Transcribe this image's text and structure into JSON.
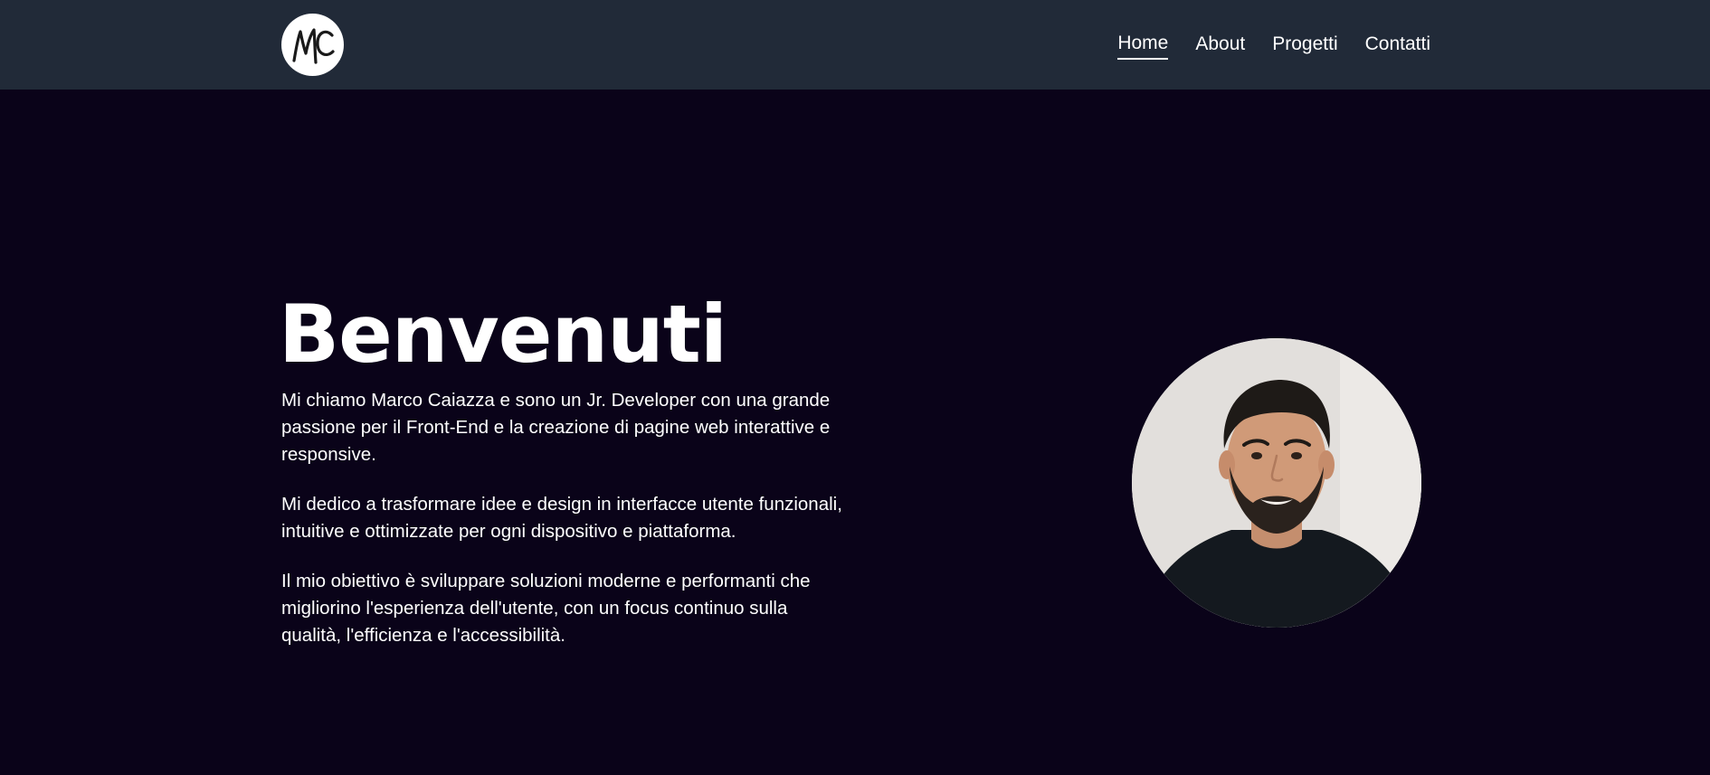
{
  "header": {
    "logo_text": "MC",
    "nav": [
      {
        "label": "Home",
        "active": true
      },
      {
        "label": "About",
        "active": false
      },
      {
        "label": "Progetti",
        "active": false
      },
      {
        "label": "Contatti",
        "active": false
      }
    ]
  },
  "hero": {
    "title": "Benvenuti",
    "paragraphs": [
      "Mi chiamo Marco Caiazza e sono un Jr. Developer con una grande passione per il Front-End e la creazione di pagine web interattive e responsive.",
      "Mi dedico a trasformare idee e design in interfacce utente funzionali, intuitive e ottimizzate per ogni dispositivo e piattaforma.",
      "Il mio obiettivo è sviluppare soluzioni moderne e performanti che migliorino l'esperienza dell'utente, con un focus continuo sulla qualità, l'efficienza e l'accessibilità."
    ]
  },
  "colors": {
    "navbar_bg": "#212a38",
    "page_bg": "#0a0319",
    "text": "#ffffff"
  },
  "icons": {
    "logo": "mc-monogram-logo",
    "portrait": "profile-photo"
  }
}
